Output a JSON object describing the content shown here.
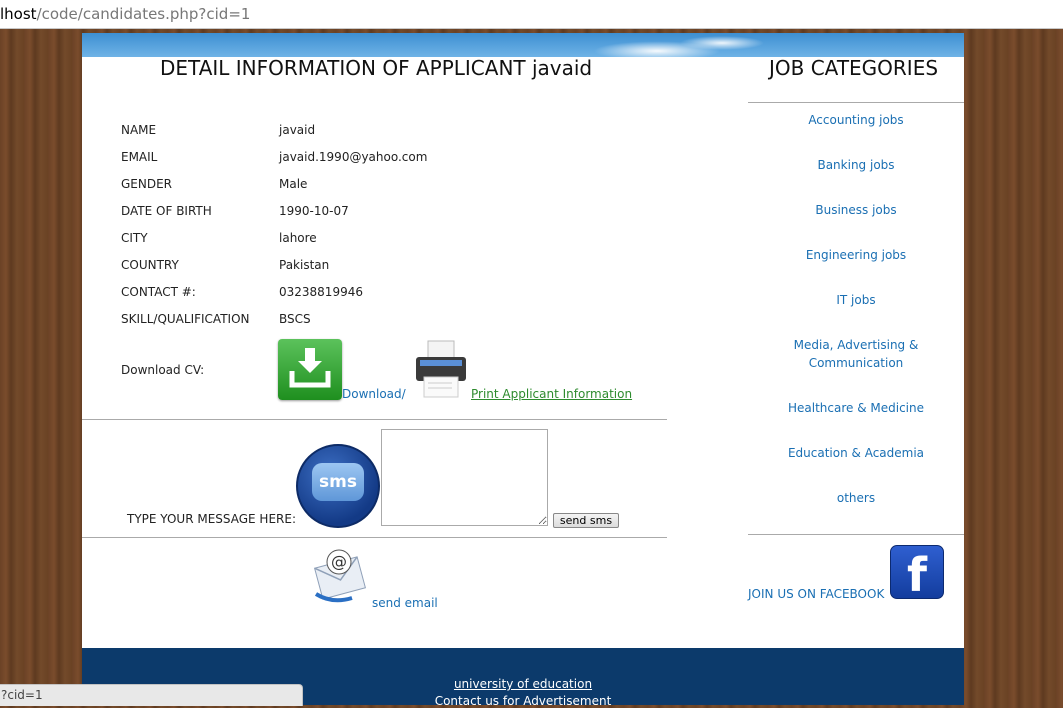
{
  "browser": {
    "url_host": "lhost",
    "url_path": "/code/candidates.php?cid=1",
    "status_text": "?cid=1"
  },
  "main": {
    "title": "DETAIL INFORMATION OF APPLICANT javaid",
    "details": [
      {
        "label": "NAME",
        "value": "javaid"
      },
      {
        "label": "EMAIL",
        "value": "javaid.1990@yahoo.com"
      },
      {
        "label": "GENDER",
        "value": "Male"
      },
      {
        "label": "DATE OF BIRTH",
        "value": "1990-10-07"
      },
      {
        "label": "CITY",
        "value": "lahore"
      },
      {
        "label": "COUNTRY",
        "value": "Pakistan"
      },
      {
        "label": "CONTACT #:",
        "value": "03238819946"
      },
      {
        "label": "SKILL/QUALIFICATION",
        "value": "BSCS"
      }
    ],
    "download_cv_label": "Download CV:",
    "download_link": "Download",
    "download_separator": "/",
    "print_link": "Print Applicant Information",
    "message_label": "TYPE YOUR MESSAGE HERE:",
    "sms_icon_text": "sms",
    "message_value": "",
    "send_sms_button": "send sms",
    "send_email_link": "send email"
  },
  "sidebar": {
    "title": "JOB CATEGORIES",
    "categories": [
      "Accounting jobs",
      "Banking jobs",
      "Business jobs",
      "Engineering jobs",
      "IT jobs",
      "Media, Advertising & Communication",
      "Healthcare & Medicine",
      "Education & Academia",
      "others"
    ],
    "facebook_label": "JOIN US ON FACEBOOK",
    "facebook_icon_text": "f"
  },
  "footer": {
    "link1": "university of education",
    "link2": "Contact us for Advertisement"
  },
  "colors": {
    "link": "#1a6fb3",
    "print_link": "#2e8b2e",
    "footer_bg": "#0c3a6b"
  }
}
